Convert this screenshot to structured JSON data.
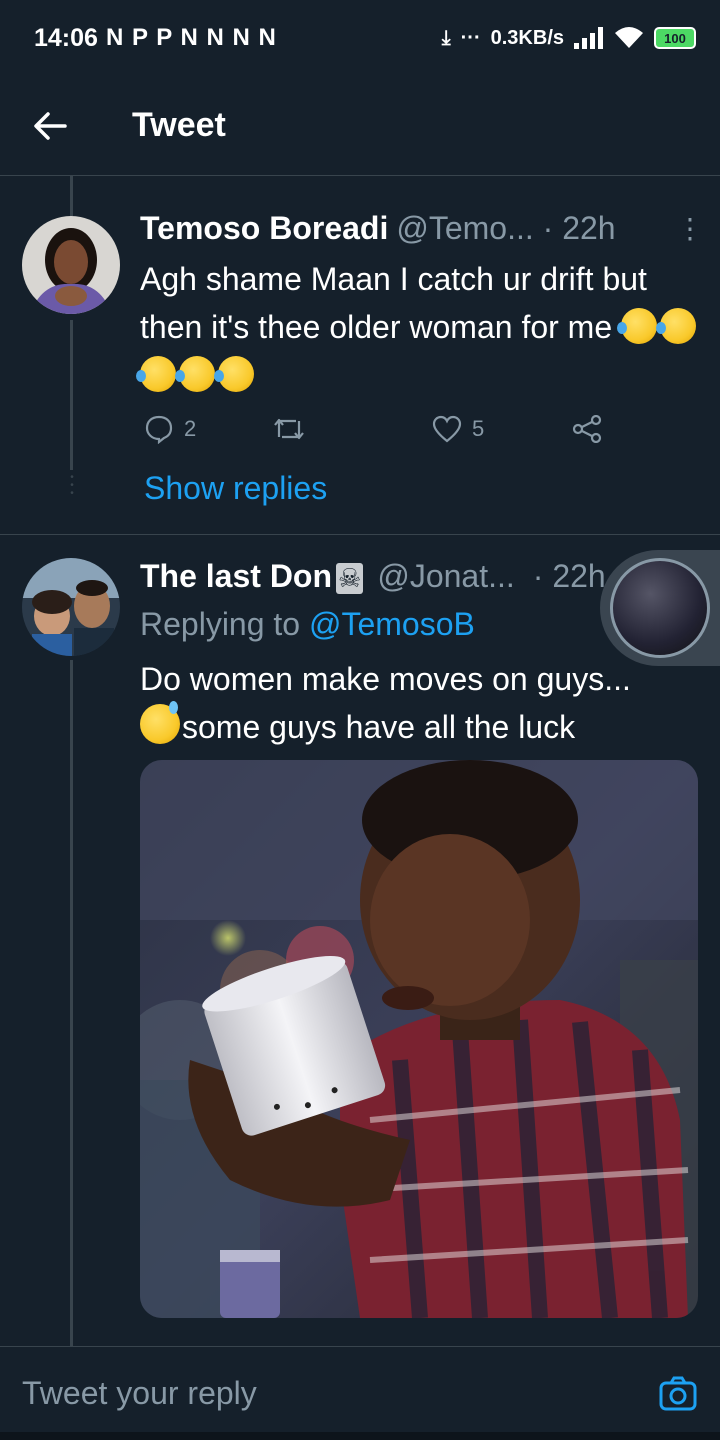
{
  "status_bar": {
    "time": "14:06",
    "notif_icons": "N P P N N N N",
    "net_speed": "0.3KB/s",
    "battery": "100"
  },
  "header": {
    "title": "Tweet"
  },
  "tweet1": {
    "name": "Temoso Boreadi",
    "handle": "@Temo... · 22h",
    "text": "Agh shame Maan I catch ur drift but then it's thee older woman for me",
    "replies": "2",
    "likes": "5",
    "show_replies": "Show replies"
  },
  "tweet2": {
    "name": "The last Don",
    "name_emoji": "☠",
    "handle": "@Jonat...",
    "time": "· 22h",
    "replying_prefix": "Replying to",
    "replying_to": "@TemosoB",
    "text_line1": "Do women make moves on guys...",
    "text_line2": "some guys have all the luck"
  },
  "reply_bar": {
    "placeholder": "Tweet your reply"
  },
  "colors": {
    "background": "#15202b",
    "accent": "#1da1f2",
    "secondary_text": "#8899a6",
    "divider": "#38444d"
  },
  "icons": {
    "back": "arrow-left-icon",
    "reply": "speech-bubble-icon",
    "retweet": "retweet-icon",
    "like": "heart-icon",
    "share": "share-icon",
    "camera": "camera-icon"
  }
}
